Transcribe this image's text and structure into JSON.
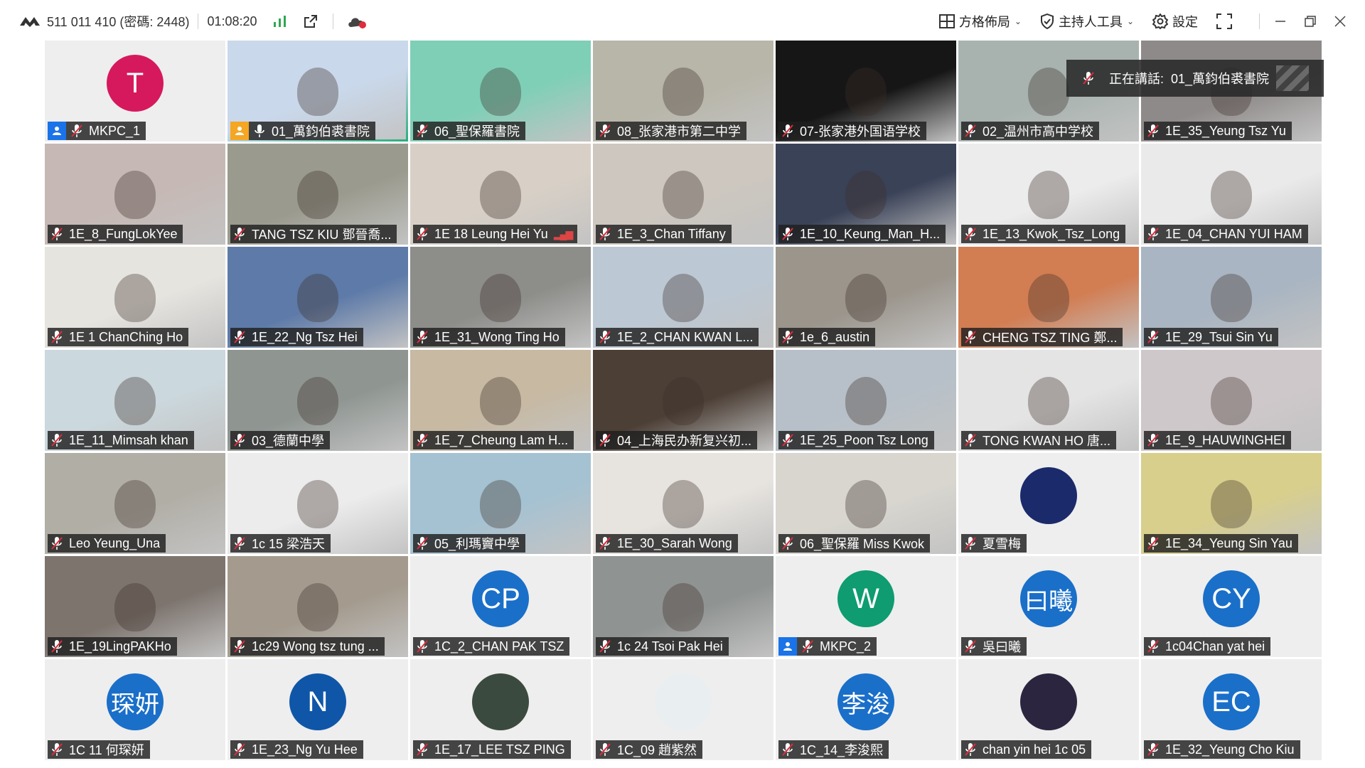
{
  "topbar": {
    "meeting_id": "511 011 410 (密碼: 2448)",
    "timer": "01:08:20",
    "layout_label": "方格佈局",
    "host_tools_label": "主持人工具",
    "settings_label": "設定",
    "colors": {
      "signal": "#2fa84f",
      "accent": "#e02c3c"
    }
  },
  "speaking_toast": {
    "prefix": "正在講話:",
    "name": "01_萬鈞伯裘書院"
  },
  "tiles": [
    {
      "name": "MKPC_1",
      "type": "avatar",
      "initials": "T",
      "color": "#d6195c",
      "host": true
    },
    {
      "name": "01_萬鈞伯裘書院",
      "type": "video",
      "bg": "#c9d8ea",
      "active": true,
      "host_orange": true,
      "unmuted": true
    },
    {
      "name": "06_聖保羅書院",
      "type": "video",
      "bg": "#7fcfb7"
    },
    {
      "name": "08_张家港市第二中学",
      "type": "video",
      "bg": "#b8b6a9"
    },
    {
      "name": "07-张家港外国语学校",
      "type": "video",
      "bg": "#161616"
    },
    {
      "name": "02_温州市高中学校",
      "type": "video",
      "bg": "#a8b3b0"
    },
    {
      "name": "1E_35_Yeung Tsz Yu",
      "type": "video",
      "bg": "#8f8a8a"
    },
    {
      "name": "1E_8_FungLokYee",
      "type": "video",
      "bg": "#c6b9b5"
    },
    {
      "name": "TANG TSZ KIU 鄧晉喬...",
      "type": "video",
      "bg": "#9a9a8e"
    },
    {
      "name": "1E 18 Leung Hei Yu",
      "type": "video",
      "bg": "#d8d0c6",
      "signal": true
    },
    {
      "name": "1E_3_Chan Tiffany",
      "type": "video",
      "bg": "#cdc7bf"
    },
    {
      "name": "1E_10_Keung_Man_H...",
      "type": "video",
      "bg": "#3a4258"
    },
    {
      "name": "1E_13_Kwok_Tsz_Long",
      "type": "video",
      "bg": "#ececec"
    },
    {
      "name": "1E_04_CHAN YUI HAM",
      "type": "video",
      "bg": "#eaeaea"
    },
    {
      "name": "1E 1 ChanChing Ho",
      "type": "video",
      "bg": "#e6e4df"
    },
    {
      "name": "1E_22_Ng Tsz Hei",
      "type": "video",
      "bg": "#5d7aa8"
    },
    {
      "name": "1E_31_Wong Ting Ho",
      "type": "video",
      "bg": "#8d8d8a"
    },
    {
      "name": "1E_2_CHAN KWAN L...",
      "type": "video",
      "bg": "#bcc8d4"
    },
    {
      "name": "1e_6_austin",
      "type": "video",
      "bg": "#9b958c"
    },
    {
      "name": "CHENG TSZ TING 鄭...",
      "type": "video",
      "bg": "#d27d52"
    },
    {
      "name": "1E_29_Tsui Sin Yu",
      "type": "video",
      "bg": "#a9b5c2"
    },
    {
      "name": "1E_11_Mimsah khan",
      "type": "video",
      "bg": "#cbd8dd"
    },
    {
      "name": "03_德蘭中學",
      "type": "video",
      "bg": "#8f9692"
    },
    {
      "name": "1E_7_Cheung Lam H...",
      "type": "video",
      "bg": "#c7b9a2"
    },
    {
      "name": "04_上海民办新复兴初...",
      "type": "video",
      "bg": "#4c3f36"
    },
    {
      "name": "1E_25_Poon Tsz Long",
      "type": "video",
      "bg": "#b7c0c8"
    },
    {
      "name": "TONG KWAN HO 唐...",
      "type": "video",
      "bg": "#e4e4e4"
    },
    {
      "name": "1E_9_HAUWINGHEI",
      "type": "video",
      "bg": "#cfc8cb"
    },
    {
      "name": "Leo Yeung_Una",
      "type": "video",
      "bg": "#b1aea6"
    },
    {
      "name": "1c 15 梁浩天",
      "type": "video",
      "bg": "#ececec"
    },
    {
      "name": "05_利瑪竇中學",
      "type": "video",
      "bg": "#a5c2d2"
    },
    {
      "name": "1E_30_Sarah Wong",
      "type": "video",
      "bg": "#e7e4df"
    },
    {
      "name": "06_聖保羅 Miss Kwok",
      "type": "video",
      "bg": "#d8d6cf"
    },
    {
      "name": "夏雪梅",
      "type": "avatar",
      "initials": "",
      "color": "#1b2a6b",
      "picture": true
    },
    {
      "name": "1E_34_Yeung Sin Yau",
      "type": "video",
      "bg": "#d8cf8c"
    },
    {
      "name": "1E_19LingPAKHo",
      "type": "video",
      "bg": "#7d746e"
    },
    {
      "name": "1c29 Wong tsz tung ...",
      "type": "video",
      "bg": "#a49b8e"
    },
    {
      "name": "1C_2_CHAN PAK TSZ",
      "type": "avatar",
      "initials": "CP",
      "color": "#1a6fc9"
    },
    {
      "name": "1c 24 Tsoi Pak Hei",
      "type": "video",
      "bg": "#8f9391"
    },
    {
      "name": "MKPC_2",
      "type": "avatar",
      "initials": "W",
      "color": "#0e9c70",
      "host": true
    },
    {
      "name": "吳曰曦",
      "type": "avatar",
      "initials": "曰曦",
      "color": "#1a6fc9",
      "cjk": true
    },
    {
      "name": "1c04Chan yat hei",
      "type": "avatar",
      "initials": "CY",
      "color": "#1a6fc9"
    },
    {
      "name": "1C 11 何琛妍",
      "type": "avatar",
      "initials": "琛妍",
      "color": "#1a6fc9",
      "cjk": true
    },
    {
      "name": "1E_23_Ng Yu Hee",
      "type": "avatar",
      "initials": "N",
      "color": "#0f56a8"
    },
    {
      "name": "1E_17_LEE TSZ PING",
      "type": "avatar",
      "initials": "",
      "color": "#3b4a3e",
      "picture": true
    },
    {
      "name": "1C_09 趙紫然",
      "type": "avatar",
      "initials": "",
      "color": "#e9eef1",
      "picture": true
    },
    {
      "name": "1C_14_李浚熙",
      "type": "avatar",
      "initials": "李浚",
      "color": "#1a6fc9",
      "cjk": true
    },
    {
      "name": "chan yin hei 1c 05",
      "type": "avatar",
      "initials": "",
      "color": "#2b2540",
      "picture": true
    },
    {
      "name": "1E_32_Yeung Cho Kiu",
      "type": "avatar",
      "initials": "EC",
      "color": "#1a6fc9"
    }
  ]
}
